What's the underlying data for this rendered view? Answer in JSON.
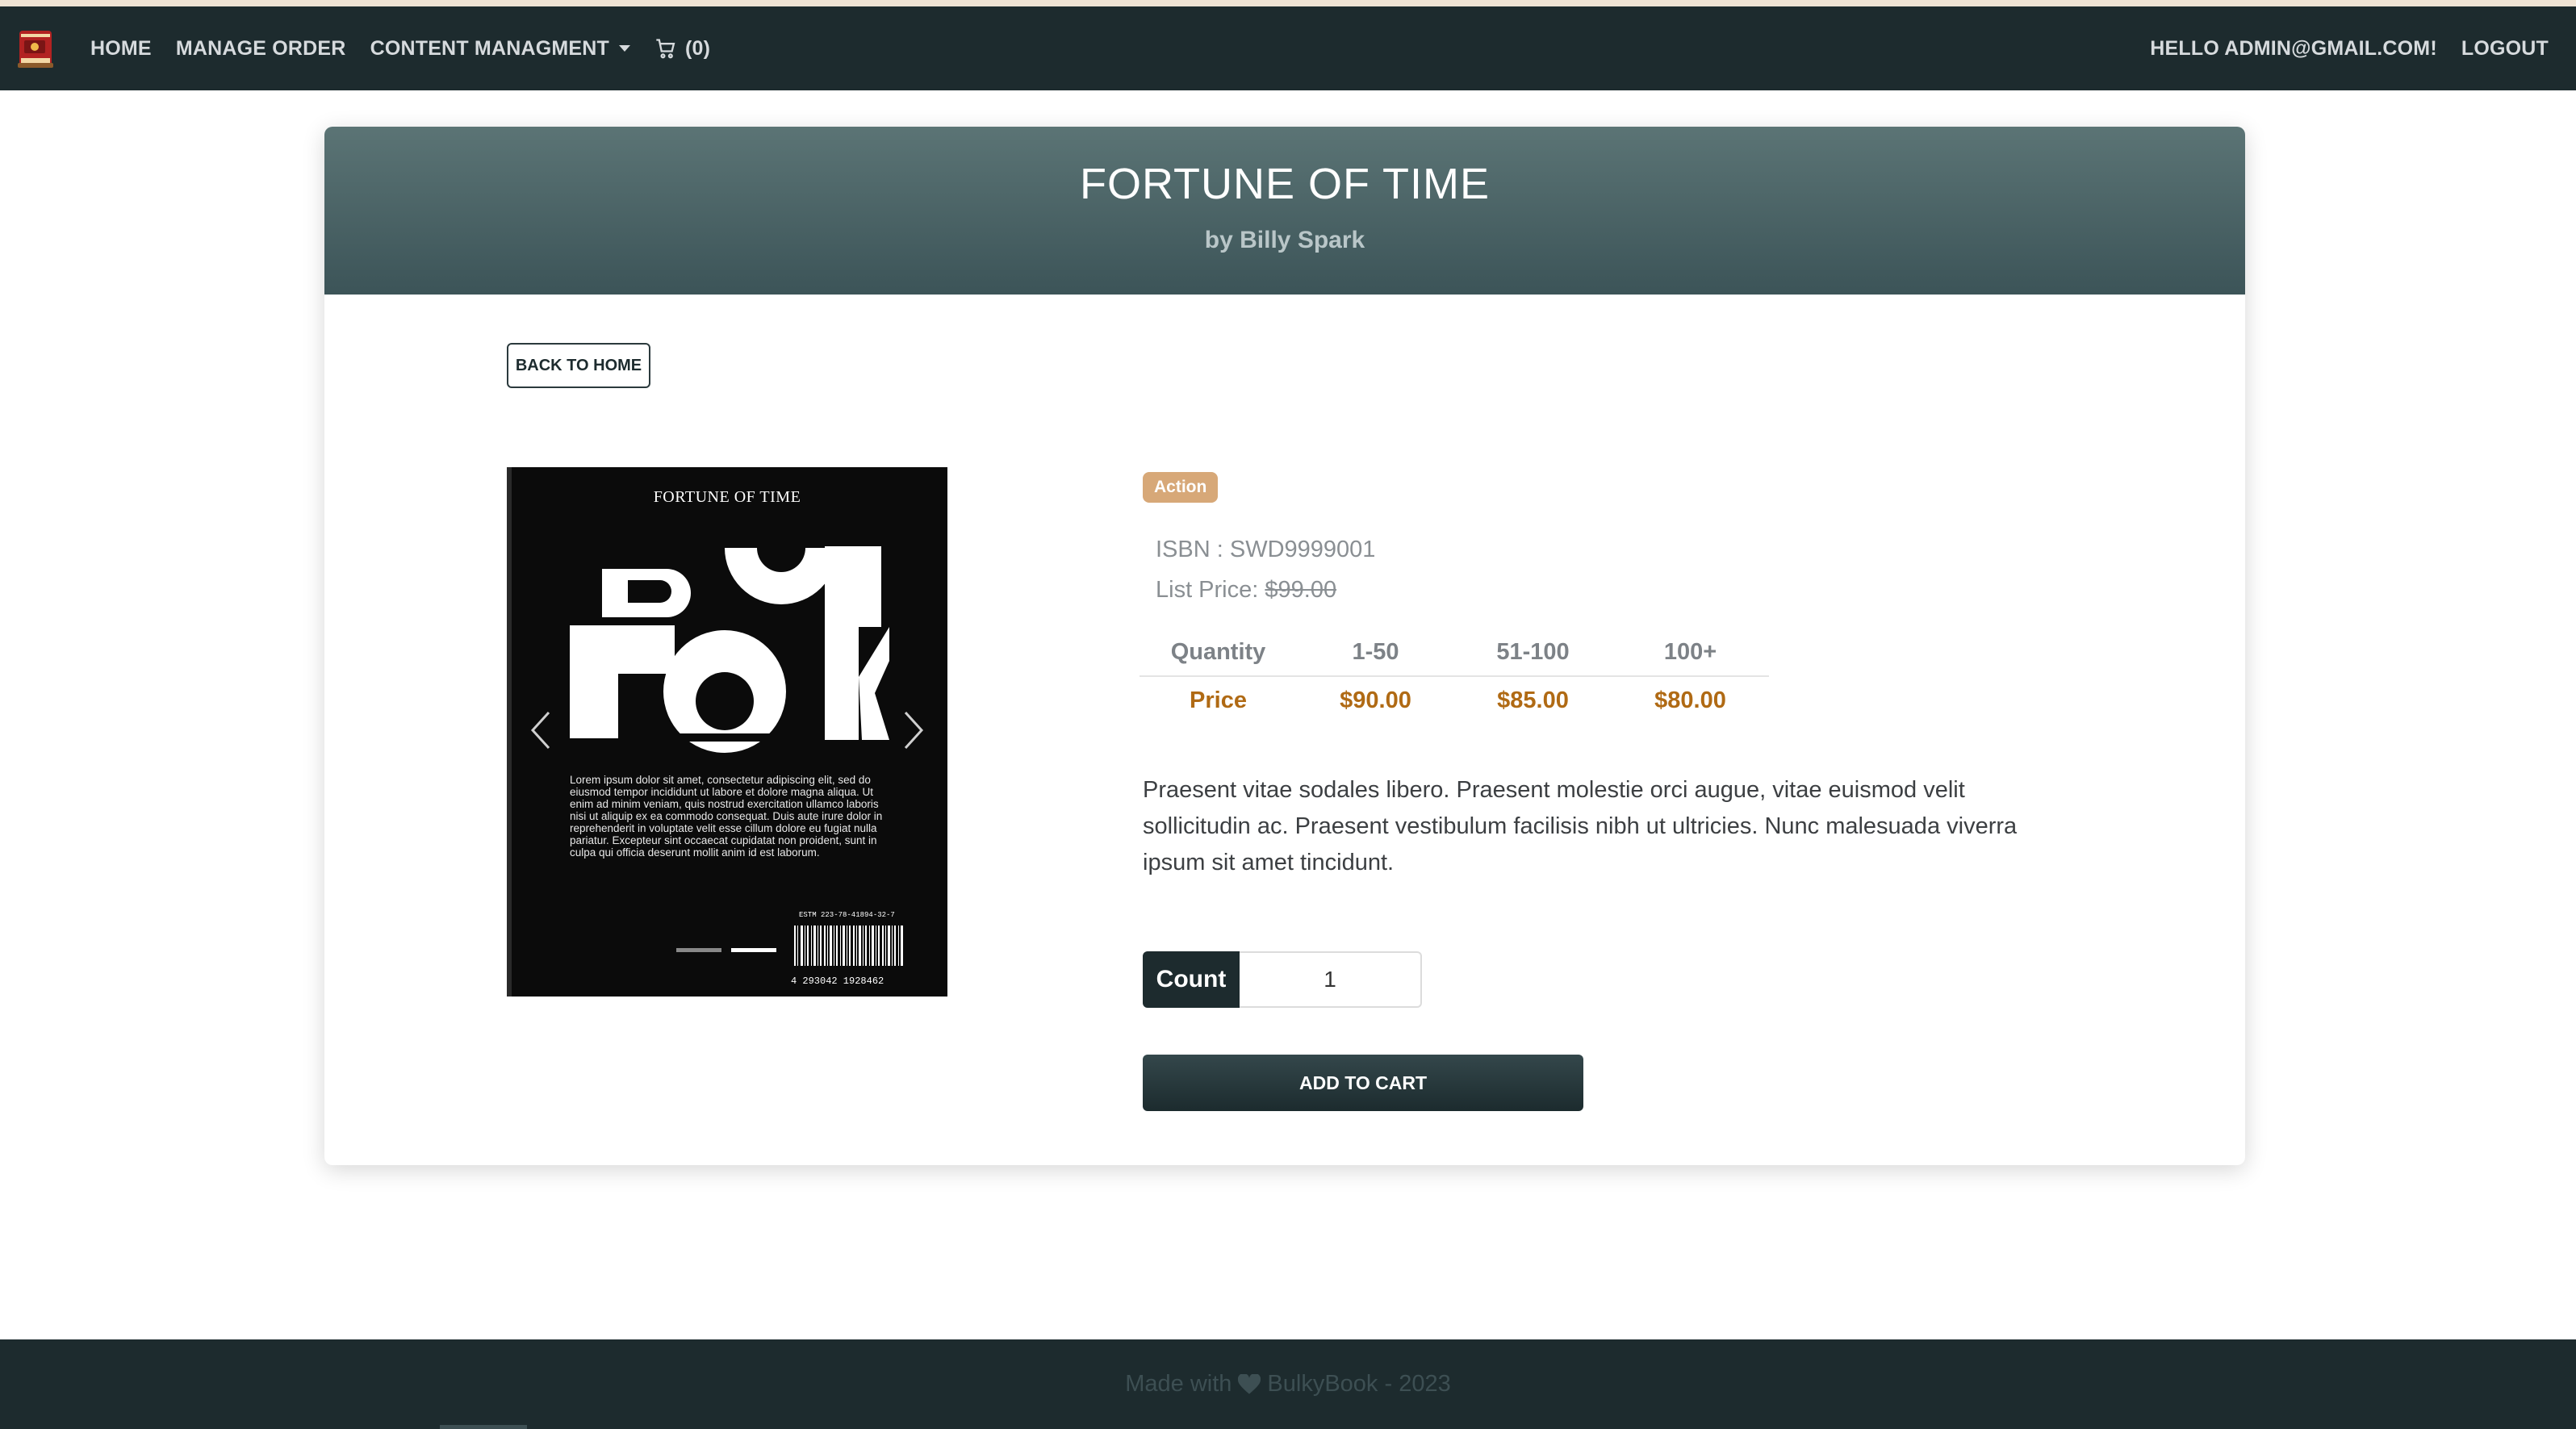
{
  "nav": {
    "home": "HOME",
    "manage_order": "MANAGE ORDER",
    "content_management": "CONTENT MANAGMENT",
    "cart_count": "(0)",
    "greeting": "HELLO ADMIN@GMAIL.COM!",
    "logout": "LOGOUT"
  },
  "product": {
    "title": "FORTUNE OF TIME",
    "author": "by Billy Spark",
    "back_label": "BACK TO HOME",
    "category": "Action",
    "isbn": "ISBN : SWD9999001",
    "list_price_label": "List Price: ",
    "list_price": "$99.00",
    "description": "Praesent vitae sodales libero. Praesent molestie orci augue, vitae euismod velit sollicitudin ac. Praesent vestibulum facilisis nibh ut ultricies. Nunc malesuada viverra ipsum sit amet tincidunt.",
    "count_label": "Count",
    "count_value": "1",
    "add_to_cart": "ADD TO CART"
  },
  "price_table": {
    "headers": [
      "Quantity",
      "1-50",
      "51-100",
      "100+"
    ],
    "row": [
      "Price",
      "$90.00",
      "$85.00",
      "$80.00"
    ]
  },
  "cover": {
    "title": "FORTUNE OF TIME",
    "paragraph": "Lorem ipsum dolor sit amet, consectetur adipiscing elit, sed do eiusmod tempor incididunt ut labore et dolore magna aliqua. Ut enim ad minim veniam, quis nostrud exercitation ullamco laboris nisi ut aliquip ex ea commodo consequat. Duis aute irure dolor in reprehenderit in voluptate velit esse cillum dolore eu fugiat nulla pariatur. Excepteur sint occaecat cupidatat non proident, sunt in culpa qui officia deserunt mollit anim id est laborum.",
    "barcode_label": "ESTM  223-78-41894-32-7",
    "barcode_number": "4  293042  1928462"
  },
  "footer": {
    "made_with": "Made with",
    "brand": "BulkyBook - 2023"
  },
  "colors": {
    "navbar": "#1d2b2e",
    "header_gradient_top": "#5b7475",
    "header_gradient_bottom": "#3c5458",
    "badge": "#d7a878",
    "price_accent": "#b06a14"
  },
  "icons": {
    "logo": "book-logo-icon",
    "cart": "cart-icon",
    "caret": "chevron-down-icon",
    "heart": "heart-icon",
    "prev": "chevron-left-icon",
    "next": "chevron-right-icon"
  }
}
